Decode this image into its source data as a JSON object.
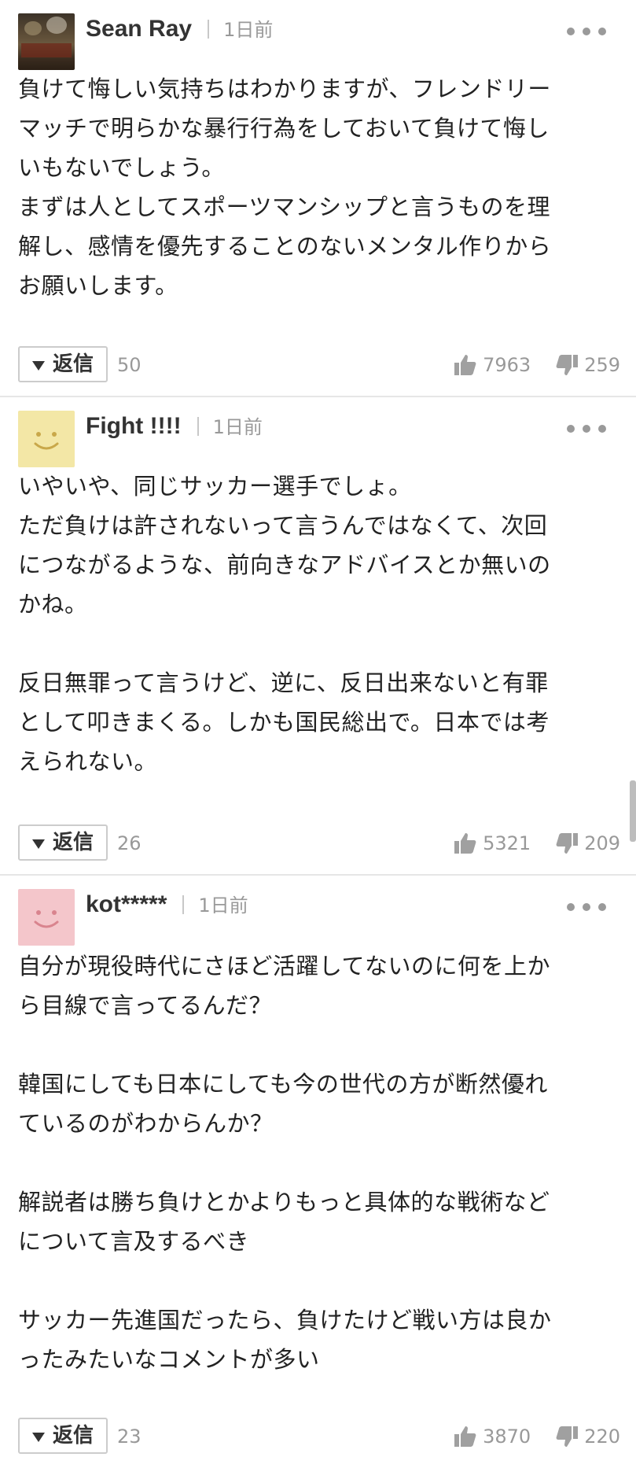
{
  "comments": [
    {
      "username": "Sean Ray",
      "time": "1日前",
      "avatar": "landscape-photo-avatar",
      "text": "負けて悔しい気持ちはわかりますが、フレンドリー\nマッチで明らかな暴行行為をしておいて負けて悔し\nいもないでしょう。\nまずは人としてスポーツマンシップと言うものを理\n解し、感情を優先することのないメンタル作りから\nお願いします。",
      "reply_label": "返信",
      "reply_count": "50",
      "likes": "7963",
      "dislikes": "259"
    },
    {
      "username": "Fight !!!!",
      "time": "1日前",
      "avatar": "yellow-smiley-avatar",
      "text": "いやいや、同じサッカー選手でしょ。\nただ負けは許されないって言うんではなくて、次回\nにつながるような、前向きなアドバイスとか無いの\nかね。\n\n反日無罪って言うけど、逆に、反日出来ないと有罪\nとして叩きまくる。しかも国民総出で。日本では考\nえられない。",
      "reply_label": "返信",
      "reply_count": "26",
      "likes": "5321",
      "dislikes": "209"
    },
    {
      "username": "kot*****",
      "time": "1日前",
      "avatar": "pink-smiley-avatar",
      "text": "自分が現役時代にさほど活躍してないのに何を上か\nら目線で言ってるんだ？\n\n韓国にしても日本にしても今の世代の方が断然優れ\nているのがわからんか？\n\n解説者は勝ち負けとかよりもっと具体的な戦術など\nについて言及するべき\n\nサッカー先進国だったら、負けたけど戦い方は良か\nったみたいなコメントが多い",
      "reply_label": "返信",
      "reply_count": "23",
      "likes": "3870",
      "dislikes": "220"
    }
  ],
  "colors": {
    "yellow_avatar": "#f3e7a6",
    "pink_avatar": "#f4c6cb",
    "muted_text": "#999999",
    "divider": "#e6e6e6"
  }
}
